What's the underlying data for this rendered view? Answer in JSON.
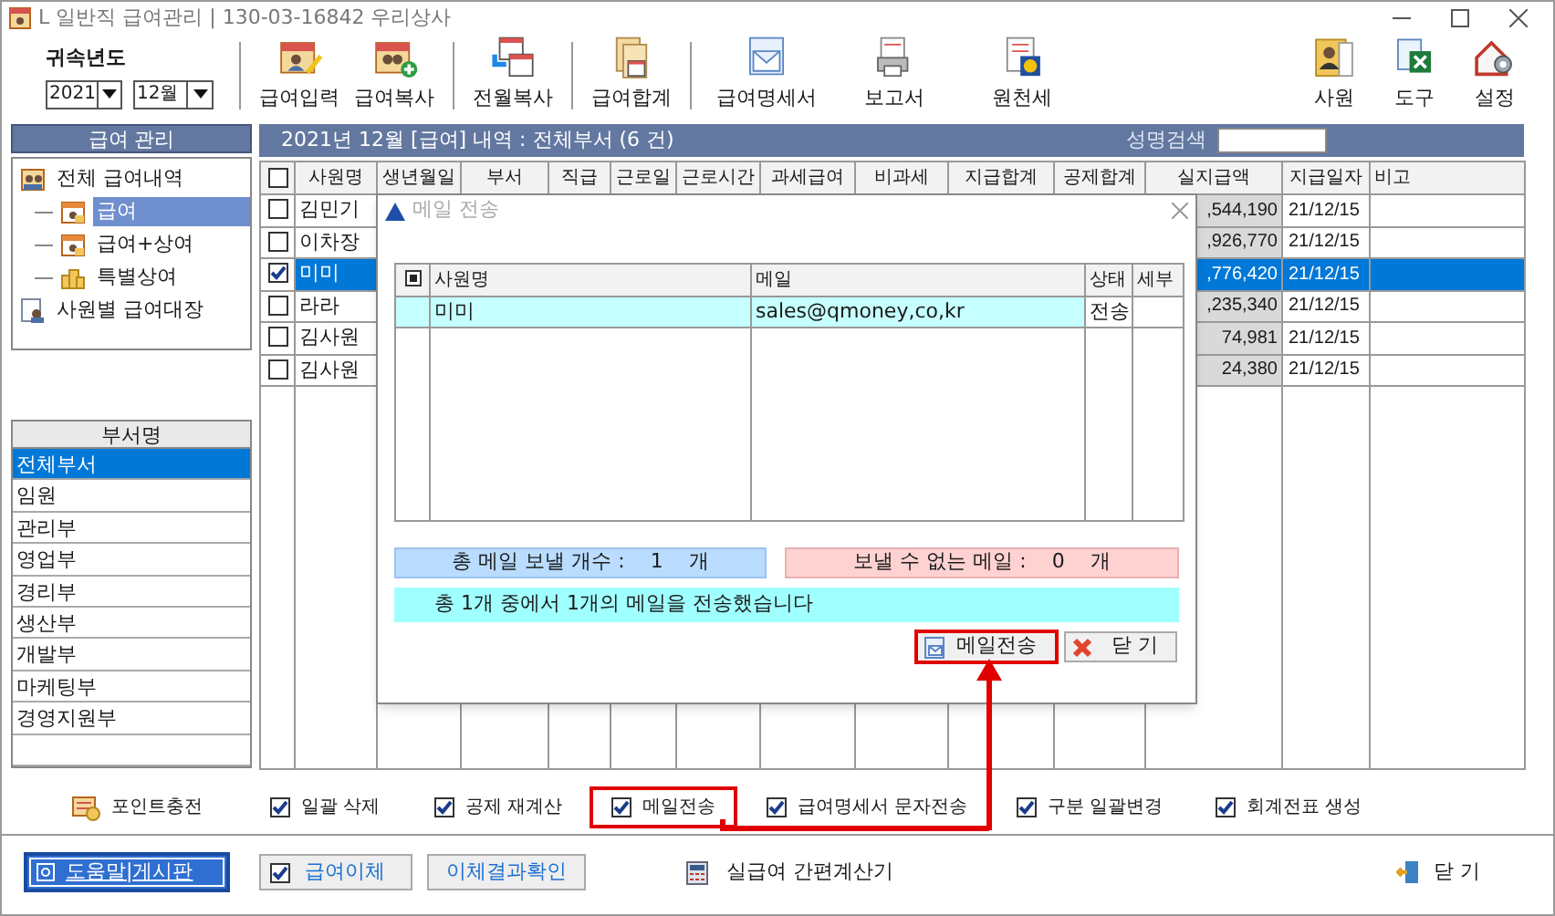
{
  "window": {
    "title": "L 일반직 급여관리 | 130-03-16842  우리상사"
  },
  "period": {
    "label": "귀속년도",
    "year": "2021",
    "month": "12월"
  },
  "toolbar_groups": [
    [
      {
        "label": "급여입력",
        "kind": "calendar-pencil"
      },
      {
        "label": "급여복사",
        "kind": "calendar-plus"
      }
    ],
    [
      {
        "label": "전월복사",
        "kind": "calendars"
      }
    ],
    [
      {
        "label": "급여합계",
        "kind": "documents"
      }
    ],
    [
      {
        "label": "급여명세서",
        "kind": "envelope"
      },
      {
        "label": "보고서",
        "kind": "printer"
      },
      {
        "label": "원천세",
        "kind": "document-badge"
      }
    ]
  ],
  "right_tools": [
    {
      "label": "사원",
      "kind": "folder-person"
    },
    {
      "label": "도구",
      "kind": "spreadsheet"
    },
    {
      "label": "설정",
      "kind": "house-gear"
    }
  ],
  "payroll_panel": {
    "title": "급여 관리",
    "tree": [
      {
        "label": "전체 급여내역",
        "kind": "people",
        "selected": false,
        "children": [
          {
            "label": "급여",
            "kind": "calendar",
            "selected": true
          },
          {
            "label": "급여+상여",
            "kind": "calendar",
            "selected": false
          },
          {
            "label": "특별상여",
            "kind": "coins",
            "selected": false
          }
        ]
      },
      {
        "label": "사원별 급여대장",
        "kind": "ledger",
        "selected": false
      }
    ]
  },
  "department_panel": {
    "title": "부서명",
    "items": [
      {
        "label": "전체부서",
        "selected": true
      },
      {
        "label": "임원",
        "selected": false
      },
      {
        "label": "관리부",
        "selected": false
      },
      {
        "label": "영업부",
        "selected": false
      },
      {
        "label": "경리부",
        "selected": false
      },
      {
        "label": "생산부",
        "selected": false
      },
      {
        "label": "개발부",
        "selected": false
      },
      {
        "label": "마케팅부",
        "selected": false
      },
      {
        "label": "경영지원부",
        "selected": false
      }
    ]
  },
  "grid": {
    "title": "2021년 12월 [급여] 내역 : 전체부서  (6 건)",
    "search_label": "성명검색",
    "select_all_checked": false,
    "columns": [
      "사원명",
      "생년월일",
      "부서",
      "직급",
      "근로일",
      "근로시간",
      "과세급여",
      "비과세",
      "지급합계",
      "공제합계",
      "실지급액",
      "지급일자",
      "비고"
    ],
    "rows": [
      {
        "checked": false,
        "selected": false,
        "name": "김민기",
        "net_pay": ",544,190",
        "pay_date": "21/12/15"
      },
      {
        "checked": false,
        "selected": false,
        "name": "이차장",
        "net_pay": ",926,770",
        "pay_date": "21/12/15"
      },
      {
        "checked": true,
        "selected": true,
        "name": "미미",
        "net_pay": ",776,420",
        "pay_date": "21/12/15"
      },
      {
        "checked": false,
        "selected": false,
        "name": "라라",
        "net_pay": ",235,340",
        "pay_date": "21/12/15"
      },
      {
        "checked": false,
        "selected": false,
        "name": "김사원",
        "net_pay": "74,981",
        "pay_date": "21/12/15"
      },
      {
        "checked": false,
        "selected": false,
        "name": "김사원",
        "net_pay": "24,380",
        "pay_date": "21/12/15"
      }
    ]
  },
  "mail_dialog": {
    "title": "메일 전송",
    "columns": [
      "사원명",
      "메일",
      "상태",
      "세부"
    ],
    "rows": [
      {
        "name": "미미",
        "email": "sales@qmoney,co,kr",
        "status": "전송"
      }
    ],
    "send_count": {
      "label": "총 메일 보낼 개수 :",
      "value": "1",
      "unit": "개"
    },
    "fail_count": {
      "label": "보낼 수 없는 메일 :",
      "value": "0",
      "unit": "개"
    },
    "message": "총 1개 중에서 1개의 메일을 전송했습니다",
    "send_button": "메일전송",
    "send_button_highlighted": true,
    "close_button": "닫 기"
  },
  "options": [
    {
      "kind": "button",
      "label": "포인트충전"
    },
    {
      "kind": "checkbox",
      "label": "일괄 삭제",
      "checked": true
    },
    {
      "kind": "checkbox",
      "label": "공제 재계산",
      "checked": true
    },
    {
      "kind": "checkbox",
      "label": "메일전송",
      "checked": true,
      "highlighted": true
    },
    {
      "kind": "checkbox",
      "label": "급여명세서 문자전송",
      "checked": true
    },
    {
      "kind": "checkbox",
      "label": "구분 일괄변경",
      "checked": true
    },
    {
      "kind": "checkbox",
      "label": "회계전표 생성",
      "checked": true
    }
  ],
  "footer": {
    "help": "도움말|게시판",
    "transfer": {
      "label": "급여이체",
      "checked": true
    },
    "transfer_result": "이체결과확인",
    "calculator": "실급여 간편계산기",
    "close": "닫 기"
  }
}
